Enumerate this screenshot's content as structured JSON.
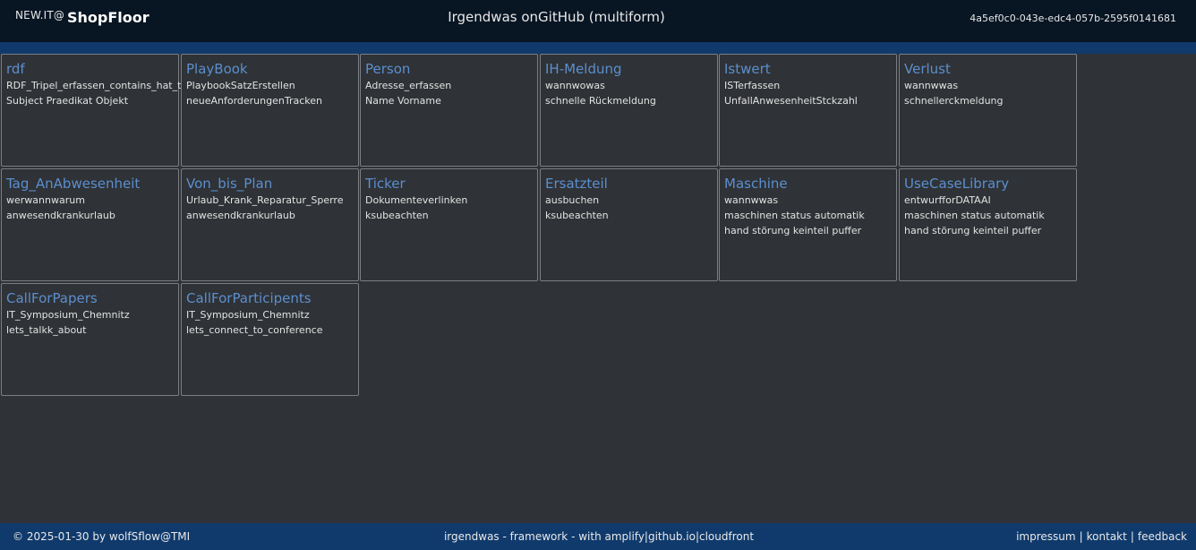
{
  "header": {
    "brand_prefix": "NEW.IT@",
    "brand_name": "ShopFloor",
    "title": "Irgendwas onGitHub (multiform)",
    "session_id": "4a5ef0c0-043e-edc4-057b-2595f0141681"
  },
  "cards": [
    {
      "title": "rdf",
      "lines": [
        "RDF_Tripel_erfassen_contains_hat_typ_...",
        "Subject Praedikat Objekt"
      ]
    },
    {
      "title": "PlayBook",
      "lines": [
        "PlaybookSatzErstellen",
        "neueAnforderungenTracken"
      ]
    },
    {
      "title": "Person",
      "lines": [
        "Adresse_erfassen",
        "Name Vorname"
      ]
    },
    {
      "title": "IH-Meldung",
      "lines": [
        "wannwowas",
        "schnelle Rückmeldung"
      ]
    },
    {
      "title": "Istwert",
      "lines": [
        "ISTerfassen",
        "UnfallAnwesenheitStckzahl"
      ]
    },
    {
      "title": "Verlust",
      "lines": [
        "wannwwas",
        "schnellerckmeldung"
      ]
    },
    {
      "title": "Tag_AnAbwesenheit",
      "lines": [
        "werwannwarum",
        "anwesendkrankurlaub"
      ]
    },
    {
      "title": "Von_bis_Plan",
      "lines": [
        "Urlaub_Krank_Reparatur_Sperre",
        "anwesendkrankurlaub"
      ]
    },
    {
      "title": "Ticker",
      "lines": [
        "Dokumenteverlinken",
        "ksubeachten"
      ]
    },
    {
      "title": "Ersatzteil",
      "lines": [
        "ausbuchen",
        "ksubeachten"
      ]
    },
    {
      "title": "Maschine",
      "lines": [
        "wannwwas",
        "maschinen status automatik",
        "hand störung keinteil puffer"
      ]
    },
    {
      "title": "UseCaseLibrary",
      "lines": [
        "entwurfforDATAAI",
        "maschinen status automatik",
        "hand störung keinteil puffer"
      ]
    },
    {
      "title": "CallForPapers",
      "lines": [
        "IT_Symposium_Chemnitz",
        "lets_talkk_about"
      ]
    },
    {
      "title": "CallForParticipents",
      "lines": [
        "IT_Symposium_Chemnitz",
        "lets_connect_to_conference"
      ]
    }
  ],
  "footer": {
    "copyright": "© 2025-01-30 by wolfSflow@TMI",
    "center": "irgendwas - framework - with amplify|github.io|cloudfront",
    "links": [
      "impressum",
      "kontakt",
      "feedback"
    ],
    "separator": "|"
  },
  "colors": {
    "header_bg": "#081523",
    "accent_bar": "#103a6c",
    "page_bg": "#2f3236",
    "card_title": "#5b8fcf",
    "card_border": "#7b7f84"
  }
}
